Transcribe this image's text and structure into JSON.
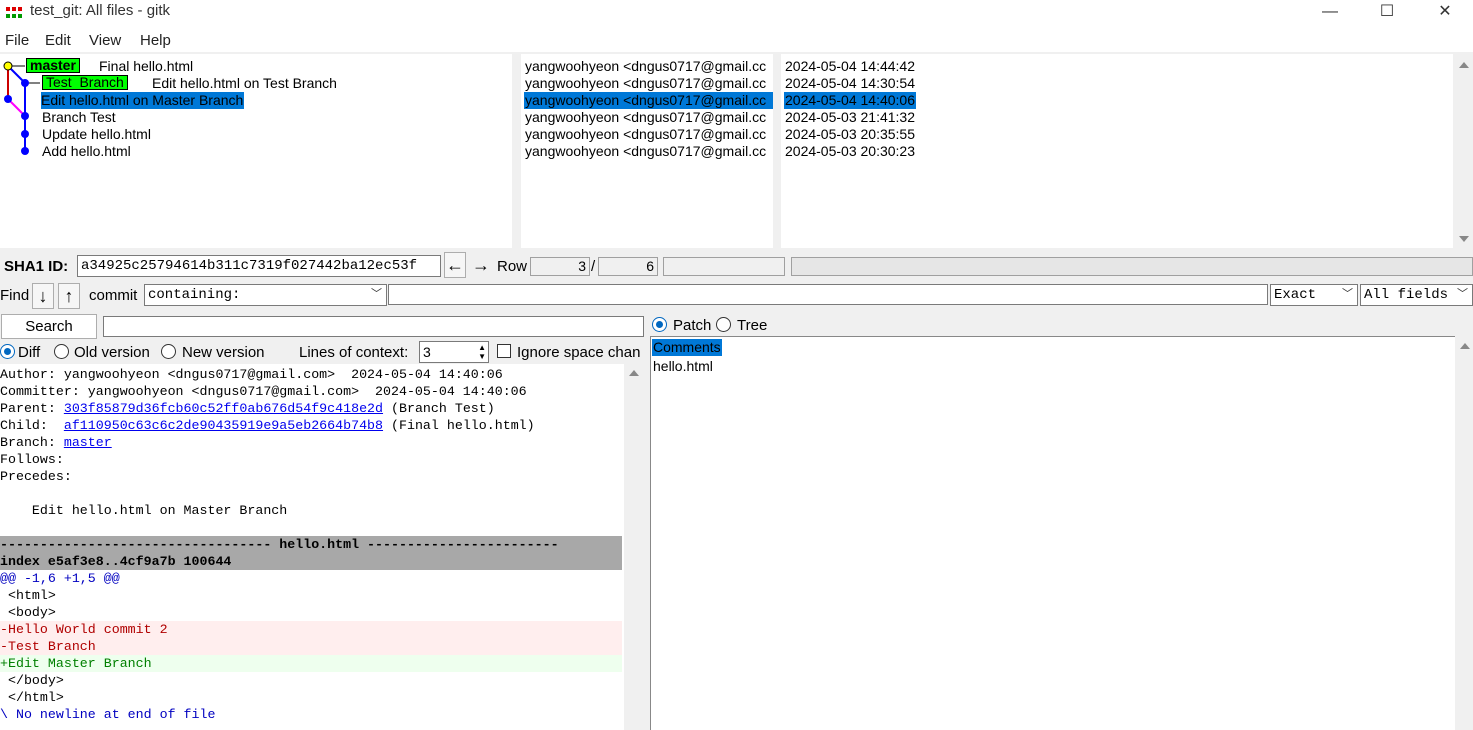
{
  "window": {
    "title": "test_git: All files - gitk",
    "minimize": "—",
    "maximize": "☐",
    "close": "✕"
  },
  "menu": [
    "File",
    "Edit",
    "View",
    "Help"
  ],
  "commits": [
    {
      "subject": "Final hello.html",
      "author": "yangwoohyeon <dngus0717@gmail.cc",
      "date": "2024-05-04 14:44:42",
      "tag": "master"
    },
    {
      "subject": "Edit hello.html on Test Branch",
      "author": "yangwoohyeon <dngus0717@gmail.cc",
      "date": "2024-05-04 14:30:54",
      "tag": "Test_Branch"
    },
    {
      "subject": "Edit hello.html on Master Branch",
      "author": "yangwoohyeon <dngus0717@gmail.cc",
      "date": "2024-05-04 14:40:06",
      "tag": ""
    },
    {
      "subject": "Branch Test",
      "author": "yangwoohyeon <dngus0717@gmail.cc",
      "date": "2024-05-03 21:41:32",
      "tag": ""
    },
    {
      "subject": "Update hello.html",
      "author": "yangwoohyeon <dngus0717@gmail.cc",
      "date": "2024-05-03 20:35:55",
      "tag": ""
    },
    {
      "subject": "Add hello.html",
      "author": "yangwoohyeon <dngus0717@gmail.cc",
      "date": "2024-05-03 20:30:23",
      "tag": ""
    }
  ],
  "selected_row": 2,
  "sha": {
    "label": "SHA1 ID:",
    "value": "a34925c25794614b311c7319f027442ba12ec53f",
    "row_label": "Row",
    "row_current": "3",
    "row_sep": "/",
    "row_total": "6"
  },
  "find": {
    "label": "Find",
    "type_label": "commit",
    "mode": "containing:",
    "match": "Exact",
    "fields": "All fields",
    "query": ""
  },
  "search": {
    "button": "Search",
    "query": ""
  },
  "diff_options": {
    "diff": "Diff",
    "old": "Old version",
    "new": "New version",
    "context_label": "Lines of context:",
    "context": "3",
    "ignore_space": "Ignore space chan"
  },
  "right_options": {
    "patch": "Patch",
    "tree": "Tree"
  },
  "files": {
    "comments": "Comments",
    "items": [
      "hello.html"
    ]
  },
  "details": {
    "author": "Author: yangwoohyeon <dngus0717@gmail.com>  2024-05-04 14:40:06",
    "committer": "Committer: yangwoohyeon <dngus0717@gmail.com>  2024-05-04 14:40:06",
    "parent_label": "Parent: ",
    "parent_sha": "303f85879d36fcb60c52ff0ab676d54f9c418e2d",
    "parent_note": " (Branch Test)",
    "child_label": "Child:  ",
    "child_sha": "af110950c63c6c2de90435919e9a5eb2664b74b8",
    "child_note": " (Final hello.html)",
    "branch_label": "Branch: ",
    "branch": "master",
    "follows": "Follows:",
    "precedes": "Precedes:",
    "message": "    Edit hello.html on Master Branch"
  },
  "diff_lines": [
    {
      "text": "---------------------------------- hello.html ------------------------",
      "kind": "hdr"
    },
    {
      "text": "index e5af3e8..4cf9a7b 100644",
      "kind": "hdr"
    },
    {
      "text": "@@ -1,6 +1,5 @@",
      "kind": "hunk"
    },
    {
      "text": " <html>",
      "kind": "ctx"
    },
    {
      "text": " <body>",
      "kind": "ctx"
    },
    {
      "text": "-Hello World commit 2",
      "kind": "del"
    },
    {
      "text": "-Test Branch",
      "kind": "del"
    },
    {
      "text": "+Edit Master Branch",
      "kind": "add"
    },
    {
      "text": " </body>",
      "kind": "ctx"
    },
    {
      "text": " </html>",
      "kind": "ctx"
    },
    {
      "text": "\\ No newline at end of file",
      "kind": "hunk"
    }
  ],
  "colors": {
    "selection": "#0078d7",
    "tag_green": "#00ff00",
    "graph_blue": "#0000ff",
    "graph_magenta": "#ff00ff",
    "graph_red": "#cc0000",
    "head_yellow": "#ffff00"
  }
}
